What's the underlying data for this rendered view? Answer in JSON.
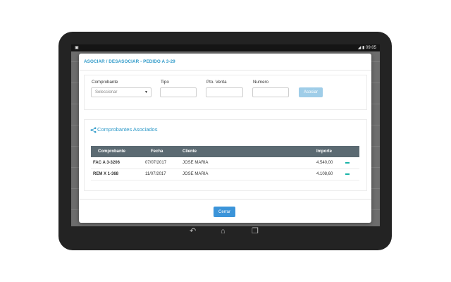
{
  "status": {
    "time": "09:05"
  },
  "modal": {
    "title": "ASOCIAR / DESASOCIAR - PEDIDO A 3-29",
    "form": {
      "comprobante_label": "Comprobante",
      "comprobante_value": "Seleccionar",
      "tipo_label": "Tipo",
      "pto_venta_label": "Pto. Venta",
      "numero_label": "Numero",
      "asociar_label": "Asociar"
    },
    "section_title": "Comprobantes Asociados",
    "table": {
      "headers": [
        "Comprobante",
        "Fecha",
        "Cliente",
        "Importe"
      ],
      "rows": [
        {
          "comprobante": "FAC A 3-3206",
          "fecha": "07/07/2017",
          "cliente": "JOSE MARIA",
          "importe": "4.540,00"
        },
        {
          "comprobante": "REM X 1-368",
          "fecha": "11/07/2017",
          "cliente": "JOSE MARIA",
          "importe": "4.108,60"
        }
      ]
    },
    "close_label": "Cerrar"
  },
  "colors": {
    "accent": "#2f9ac9",
    "header_bg": "#5b6a72",
    "remove": "#19b3a8",
    "button": "#3b94d9"
  }
}
